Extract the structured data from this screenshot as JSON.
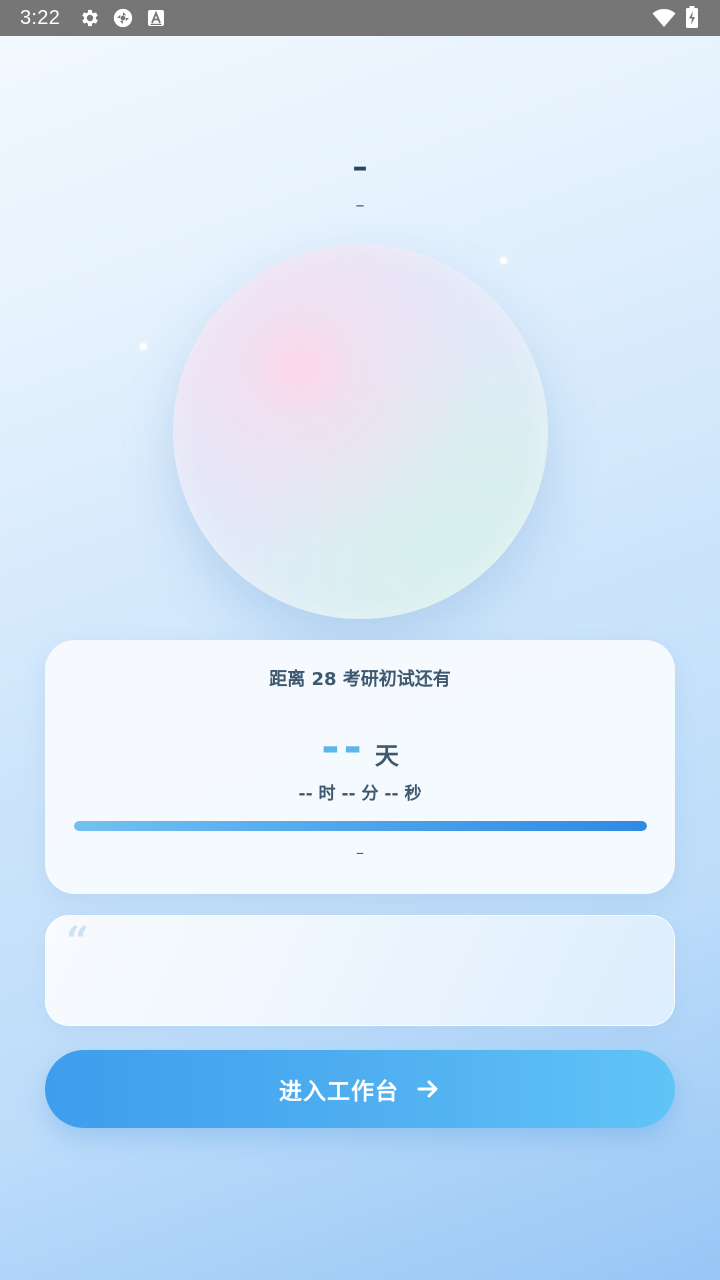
{
  "status_bar": {
    "time": "3:22",
    "icons_left": [
      "gear-icon",
      "aperture-icon",
      "text-a-icon"
    ],
    "icons_right": [
      "wifi-icon",
      "battery-charging-icon"
    ]
  },
  "header": {
    "title": "–",
    "subtitle": "–"
  },
  "countdown": {
    "title": "距离 28 考研初试还有",
    "days_value": "--",
    "days_unit": "天",
    "hms": "-- 时 -- 分 -- 秒",
    "progress": 1.0,
    "caption": "–"
  },
  "quote": {
    "mark": "“",
    "text": ""
  },
  "enter_button": {
    "label": "进入工作台",
    "icon": "arrow-right-icon"
  },
  "colors": {
    "accent": "#4aa2ea",
    "days_value": "#5fb4ec",
    "text_primary": "#3e5870",
    "status_bar": "#767676"
  }
}
